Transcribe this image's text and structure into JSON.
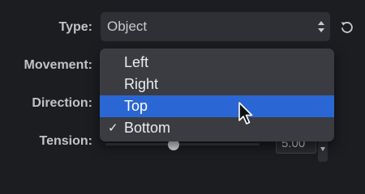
{
  "labels": {
    "type": "Type:",
    "movement": "Movement:",
    "direction": "Direction:",
    "tension": "Tension:"
  },
  "type_select": {
    "value": "Object",
    "arrow_icon": "updown-chevron-icon",
    "reset_icon": "reset-icon"
  },
  "dropdown": {
    "items": [
      {
        "label": "Left",
        "checked": false,
        "highlighted": false
      },
      {
        "label": "Right",
        "checked": false,
        "highlighted": false
      },
      {
        "label": "Top",
        "checked": false,
        "highlighted": true
      },
      {
        "label": "Bottom",
        "checked": true,
        "highlighted": false
      }
    ],
    "check_glyph": "✓"
  },
  "tension": {
    "value": "5.00"
  },
  "colors": {
    "background": "#1c1d21",
    "highlight": "#2b67d4",
    "menu": "#3b3c41"
  }
}
